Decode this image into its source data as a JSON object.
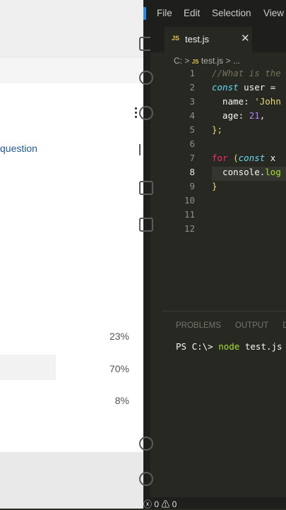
{
  "poll": {
    "question_link": "question",
    "options": [
      {
        "percent": 23,
        "percent_label": "23%"
      },
      {
        "percent": 70,
        "percent_label": "70%"
      },
      {
        "percent": 8,
        "percent_label": "8%"
      }
    ]
  },
  "menubar": {
    "file": "File",
    "edit": "Edit",
    "selection": "Selection",
    "view": "View"
  },
  "tab": {
    "badge": "JS",
    "filename": "test.js",
    "close": "✕"
  },
  "breadcrumb": {
    "drive": "C:",
    "sep1": ">",
    "badge": "JS",
    "file": "test.js",
    "sep2": ">",
    "more": "..."
  },
  "editor": {
    "line_numbers": [
      "1",
      "2",
      "3",
      "4",
      "5",
      "6",
      "7",
      "8",
      "9",
      "10",
      "11",
      "12"
    ],
    "active_line": 8,
    "lines": {
      "l1": "//What is the",
      "l2_kw": "const",
      "l2_rest": " user =",
      "l3_key": "  name: ",
      "l3_val": "'John",
      "l4_key": "  age: ",
      "l4_val": "21",
      "l4_end": ",",
      "l5": "};",
      "l7_kw": "for",
      "l7_paren": " (",
      "l7_const": "const",
      "l7_rest": " x",
      "l8_obj": "  console.",
      "l8_fn": "log",
      "l9": "}"
    }
  },
  "panel": {
    "tabs": [
      "PROBLEMS",
      "OUTPUT",
      "D"
    ],
    "terminal_prompt": "PS C:\\> ",
    "terminal_cmd": "node",
    "terminal_arg": " test.js"
  },
  "statusbar": {
    "text": "ⓧ 0 ⚠ 0"
  },
  "colors": {
    "editor_bg": "#272822",
    "link": "#1e5b9c",
    "keyword": "#66d9ef",
    "string": "#e6db74",
    "number": "#ae81ff"
  }
}
